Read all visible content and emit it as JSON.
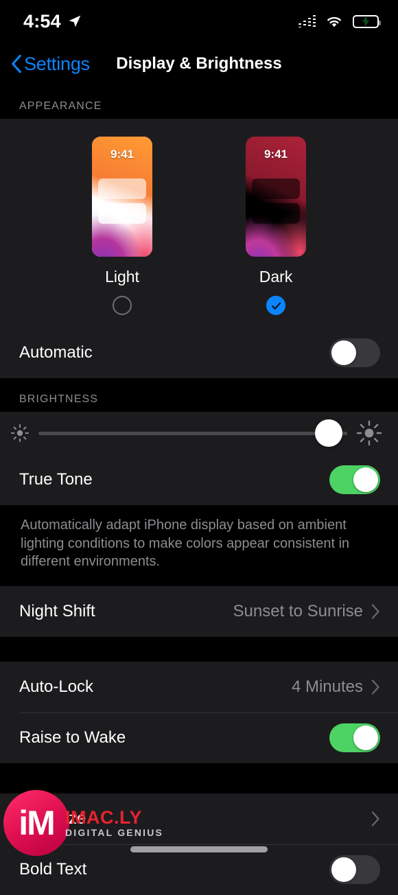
{
  "statusbar": {
    "time": "4:54",
    "location_icon": "location-arrow-icon",
    "signal_icon": "cellular-signal-icon",
    "wifi_icon": "wifi-icon",
    "battery_icon": "battery-charging-icon"
  },
  "navbar": {
    "back_label": "Settings",
    "back_icon": "chevron-left-icon",
    "title": "Display & Brightness"
  },
  "appearance": {
    "header": "APPEARANCE",
    "themes": [
      {
        "name": "Light",
        "preview_time": "9:41",
        "selected": false
      },
      {
        "name": "Dark",
        "preview_time": "9:41",
        "selected": true
      }
    ],
    "automatic": {
      "label": "Automatic",
      "on": false
    }
  },
  "brightness": {
    "header": "BRIGHTNESS",
    "slider": {
      "value": 94,
      "min_icon": "sun-low-icon",
      "max_icon": "sun-high-icon"
    },
    "true_tone": {
      "label": "True Tone",
      "on": true
    },
    "footer": "Automatically adapt iPhone display based on ambient lighting conditions to make colors appear consistent in different environments.",
    "night_shift": {
      "label": "Night Shift",
      "value": "Sunset to Sunrise"
    }
  },
  "lock": {
    "auto_lock": {
      "label": "Auto-Lock",
      "value": "4 Minutes"
    },
    "raise_to_wake": {
      "label": "Raise to Wake",
      "on": true
    }
  },
  "text": {
    "text_size": {
      "label": "Text Size"
    },
    "bold_text": {
      "label": "Bold Text",
      "on": false
    }
  },
  "watermark": {
    "mark": "iM",
    "name": "IMAC.LY",
    "tagline": "DIGITAL GENIUS"
  },
  "colors": {
    "accent_blue": "#0a84ff",
    "toggle_green": "#4cd364",
    "card_bg": "#1c1c1e",
    "page_bg": "#000000",
    "secondary_text": "#8d8d92"
  }
}
